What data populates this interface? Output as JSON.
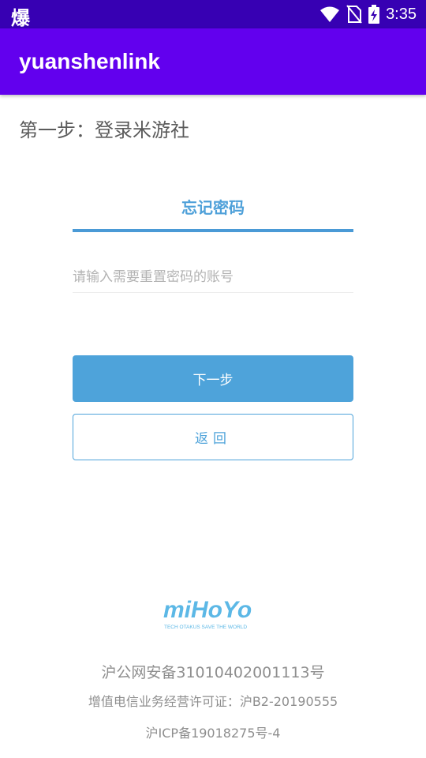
{
  "status_bar": {
    "left_glyph": "爆",
    "time": "3:35",
    "icons": [
      "wifi-icon",
      "no-sim-icon",
      "battery-charging-icon"
    ]
  },
  "app_bar": {
    "title": "yuanshenlink"
  },
  "page": {
    "step_title": "第一步：登录米游社",
    "tab_title": "忘记密码",
    "account_placeholder": "请输入需要重置密码的账号",
    "account_value": "",
    "next_label": "下一步",
    "back_label": "返回"
  },
  "logo": {
    "brand": "miHoYo",
    "tagline": "TECH OTAKUS SAVE THE WORLD",
    "color": "#5cb8e6"
  },
  "footer": {
    "line1": "沪公网安备31010402001113号",
    "line2": "增值电信业务经营许可证：沪B2-20190555",
    "line3": "沪ICP备19018275号-4"
  },
  "colors": {
    "status_bar": "#3700b3",
    "app_bar": "#6200ee",
    "accent": "#4ea3da"
  }
}
